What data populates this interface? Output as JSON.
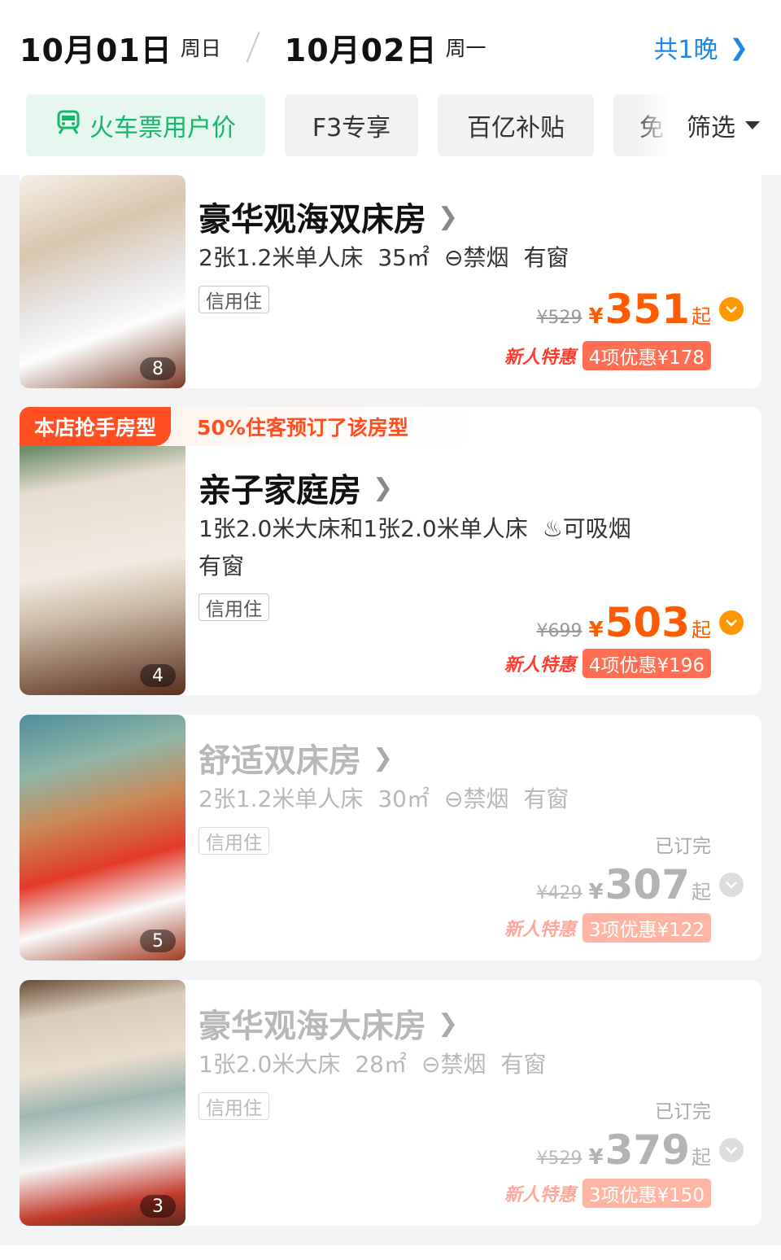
{
  "header": {
    "checkin_date": "10月01日",
    "checkin_weekday": "周日",
    "checkout_date": "10月02日",
    "checkout_weekday": "周一",
    "nights": "共1晚"
  },
  "filters": {
    "chips": [
      "火车票用户价",
      "F3专享",
      "百亿补贴",
      "免"
    ],
    "filter_label": "筛选"
  },
  "colors": {
    "accent_blue": "#1e88e5",
    "price_orange": "#ff5b00",
    "green": "#14b86b",
    "promo_red": "#ff6e52"
  },
  "rooms": [
    {
      "name": "豪华观海双床房",
      "specs": [
        "2张1.2米单人床",
        "35㎡",
        "⊖禁烟",
        "有窗"
      ],
      "tag": "信用住",
      "original_price": "¥529",
      "currency": "¥",
      "price": "351",
      "suffix": "起",
      "newbie": "新人特惠",
      "promo": "4项优惠¥178",
      "photo_count": "8",
      "sold_out": false
    },
    {
      "badge": "本店抢手房型",
      "badge_note": "50%住客预订了该房型",
      "name": "亲子家庭房",
      "specs": [
        "1张2.0米大床和1张2.0米单人床",
        "♨可吸烟"
      ],
      "specs_line2": "有窗",
      "tag": "信用住",
      "original_price": "¥699",
      "currency": "¥",
      "price": "503",
      "suffix": "起",
      "newbie": "新人特惠",
      "promo": "4项优惠¥196",
      "photo_count": "4",
      "sold_out": false
    },
    {
      "name": "舒适双床房",
      "specs": [
        "2张1.2米单人床",
        "30㎡",
        "⊖禁烟",
        "有窗"
      ],
      "tag": "信用住",
      "status": "已订完",
      "original_price": "¥429",
      "currency": "¥",
      "price": "307",
      "suffix": "起",
      "newbie": "新人特惠",
      "promo": "3项优惠¥122",
      "photo_count": "5",
      "sold_out": true
    },
    {
      "name": "豪华观海大床房",
      "specs": [
        "1张2.0米大床",
        "28㎡",
        "⊖禁烟",
        "有窗"
      ],
      "tag": "信用住",
      "status": "已订完",
      "original_price": "¥529",
      "currency": "¥",
      "price": "379",
      "suffix": "起",
      "newbie": "新人特惠",
      "promo": "3项优惠¥150",
      "photo_count": "3",
      "sold_out": true
    }
  ]
}
